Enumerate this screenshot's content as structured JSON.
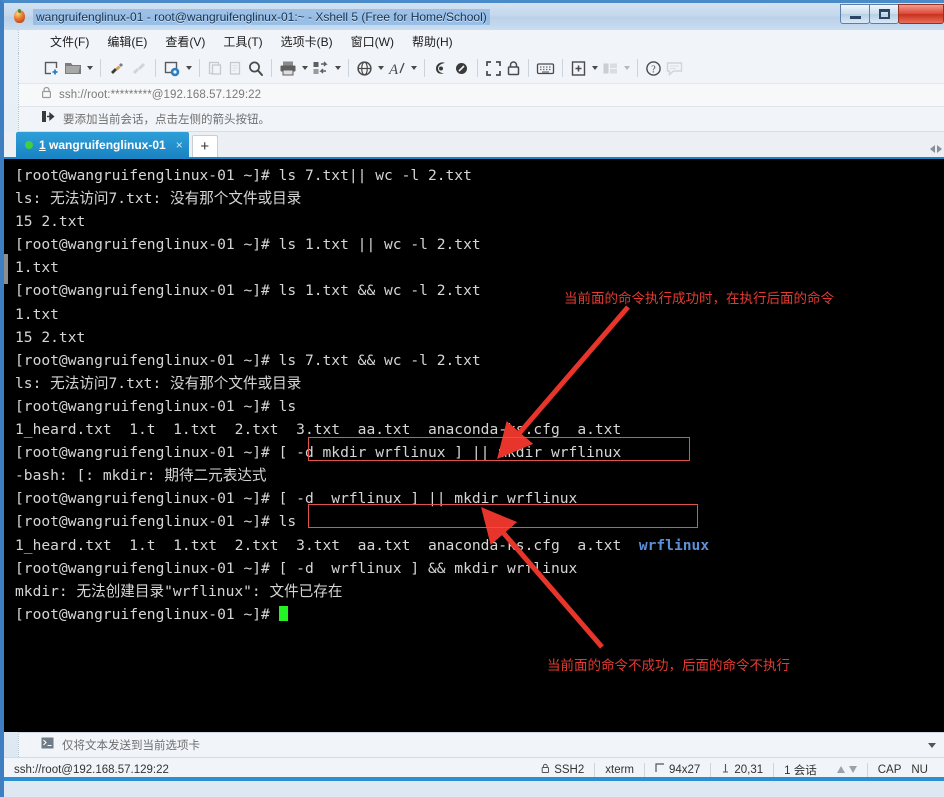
{
  "window": {
    "title": "wangruifenglinux-01 - root@wangruifenglinux-01:~ - Xshell 5 (Free for Home/School)",
    "app_icon": "xshell-icon",
    "minimize_label": "",
    "maximize_label": "",
    "close_label": ""
  },
  "menubar": {
    "items": [
      {
        "label": "文件(F)",
        "name": "menu-file"
      },
      {
        "label": "编辑(E)",
        "name": "menu-edit"
      },
      {
        "label": "查看(V)",
        "name": "menu-view"
      },
      {
        "label": "工具(T)",
        "name": "menu-tools"
      },
      {
        "label": "选项卡(B)",
        "name": "menu-tabs"
      },
      {
        "label": "窗口(W)",
        "name": "menu-window"
      },
      {
        "label": "帮助(H)",
        "name": "menu-help"
      }
    ]
  },
  "toolbar": {
    "icons": [
      "new-session-icon",
      "open-folder-icon",
      "quick-connect-icon",
      "disconnect-icon",
      "session-properties-icon",
      "paste-icon",
      "copy-icon",
      "find-icon",
      "print-icon",
      "transfer-icon",
      "web-icon",
      "font-icon",
      "ssh-tunnel-icon",
      "sftp-icon",
      "fullscreen-icon",
      "lock-icon",
      "keyboard-icon",
      "add-tab-icon",
      "arrange-icon",
      "help-icon",
      "comment-icon"
    ]
  },
  "address_bar": {
    "lock_icon": "lock-icon",
    "url": "ssh://root:*********@192.168.57.129:22"
  },
  "hint_bar": {
    "icon": "add-session-arrow-icon",
    "text": "要添加当前会话，点击左侧的箭头按钮。"
  },
  "tabs": {
    "active": {
      "number": "1",
      "label": " wangruifenglinux-01",
      "close_label": "×"
    },
    "new_tab_label": "+"
  },
  "terminal": {
    "prompt": "[root@wangruifenglinux-01 ~]#",
    "lines": [
      {
        "type": "prompt",
        "prompt": "[root@wangruifenglinux-01 ~]# ",
        "command": "ls 7.txt|| wc -l 2.txt"
      },
      {
        "type": "output",
        "text": "ls: 无法访问7.txt: 没有那个文件或目录"
      },
      {
        "type": "output",
        "text": "15 2.txt"
      },
      {
        "type": "prompt",
        "prompt": "[root@wangruifenglinux-01 ~]# ",
        "command": "ls 1.txt || wc -l 2.txt"
      },
      {
        "type": "output",
        "text": "1.txt"
      },
      {
        "type": "prompt",
        "prompt": "[root@wangruifenglinux-01 ~]# ",
        "command": "ls 1.txt && wc -l 2.txt"
      },
      {
        "type": "output",
        "text": "1.txt"
      },
      {
        "type": "output",
        "text": "15 2.txt"
      },
      {
        "type": "prompt",
        "prompt": "[root@wangruifenglinux-01 ~]# ",
        "command": "ls 7.txt && wc -l 2.txt"
      },
      {
        "type": "output",
        "text": "ls: 无法访问7.txt: 没有那个文件或目录"
      },
      {
        "type": "prompt",
        "prompt": "[root@wangruifenglinux-01 ~]# ",
        "command": "ls"
      },
      {
        "type": "output",
        "text": "1_heard.txt  1.t  1.txt  2.txt  3.txt  aa.txt  anaconda-ks.cfg  a.txt"
      },
      {
        "type": "prompt",
        "prompt": "[root@wangruifenglinux-01 ~]# ",
        "command": "[ -d mkdir wrflinux ] || mkdir wrflinux"
      },
      {
        "type": "output",
        "text": "-bash: [: mkdir: 期待二元表达式"
      },
      {
        "type": "prompt",
        "prompt": "[root@wangruifenglinux-01 ~]# ",
        "command": "[ -d  wrflinux ] || mkdir wrflinux",
        "boxed": true
      },
      {
        "type": "prompt",
        "prompt": "[root@wangruifenglinux-01 ~]# ",
        "command": "ls"
      },
      {
        "type": "output_dir",
        "text": "1_heard.txt  1.t  1.txt  2.txt  3.txt  aa.txt  anaconda-ks.cfg  a.txt  ",
        "dir": "wrflinux"
      },
      {
        "type": "prompt",
        "prompt": "[root@wangruifenglinux-01 ~]# ",
        "command": "[ -d  wrflinux ] && mkdir wrflinux",
        "boxed": true
      },
      {
        "type": "output",
        "text": "mkdir: 无法创建目录\"wrflinux\": 文件已存在"
      },
      {
        "type": "prompt_cursor",
        "prompt": "[root@wangruifenglinux-01 ~]# "
      }
    ]
  },
  "annotations": [
    {
      "name": "annotation-success",
      "text": "当前面的命令执行成功时，在执行后面的命令",
      "color": "#e23a32"
    },
    {
      "name": "annotation-failure",
      "text": "当前面的命令不成功，后面的命令不执行",
      "color": "#e23a32"
    }
  ],
  "send_bar": {
    "icon": "terminal-small-icon",
    "text": "仅将文本发送到当前选项卡"
  },
  "status_bar": {
    "url": "ssh://root@192.168.57.129:22",
    "protocol": "SSH2",
    "terminal_type": "xterm",
    "size": "94x27",
    "cursor": "20,31",
    "sessions": "1 会话",
    "caps": "CAP",
    "num": "NU"
  },
  "colors": {
    "accent": "#1b84c4",
    "terminal_bg": "#000000",
    "terminal_fg": "#d6d6d6",
    "dir_color": "#5b8fd6",
    "annotation_red": "#e23a32",
    "cursor_green": "#23f223"
  }
}
